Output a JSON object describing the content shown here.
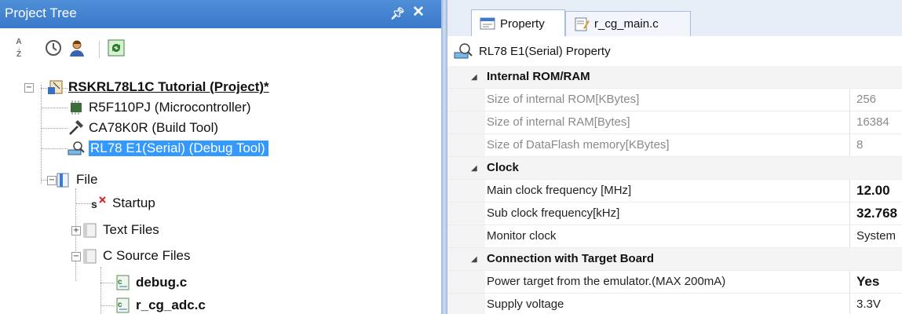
{
  "tree_panel": {
    "title": "Project Tree",
    "sort_label_top": "A",
    "sort_label_bottom": "Z",
    "nodes": {
      "project": "RSKRL78L1C Tutorial (Project)*",
      "microcontroller": "R5F110PJ (Microcontroller)",
      "build_tool": "CA78K0R (Build Tool)",
      "debug_tool": "RL78 E1(Serial) (Debug Tool)",
      "file": "File",
      "startup": "Startup",
      "text_files": "Text Files",
      "c_source_files": "C Source Files",
      "debug_c": "debug.c",
      "r_cg_adc_c": "r_cg_adc.c"
    }
  },
  "property_panel": {
    "tabs": [
      "Property",
      "r_cg_main.c"
    ],
    "title": "RL78 E1(Serial) Property",
    "categories": {
      "internal": {
        "label": "Internal ROM/RAM",
        "rows": [
          {
            "name": "Size of internal ROM[KBytes]",
            "value": "256"
          },
          {
            "name": "Size of internal RAM[Bytes]",
            "value": "16384"
          },
          {
            "name": "Size of DataFlash memory[KBytes]",
            "value": "8"
          }
        ]
      },
      "clock": {
        "label": "Clock",
        "rows": [
          {
            "name": "Main clock frequency [MHz]",
            "value": "12.00"
          },
          {
            "name": "Sub clock frequency[kHz]",
            "value": "32.768"
          },
          {
            "name": "Monitor clock",
            "value": "System"
          }
        ]
      },
      "connection": {
        "label": "Connection with Target Board",
        "rows": [
          {
            "name": "Power target from the emulator.(MAX 200mA)",
            "value": "Yes"
          },
          {
            "name": "Supply voltage",
            "value": "3.3V"
          }
        ]
      }
    }
  },
  "colors": {
    "title_bar": "#3a78c9",
    "selection": "#3399ff"
  }
}
